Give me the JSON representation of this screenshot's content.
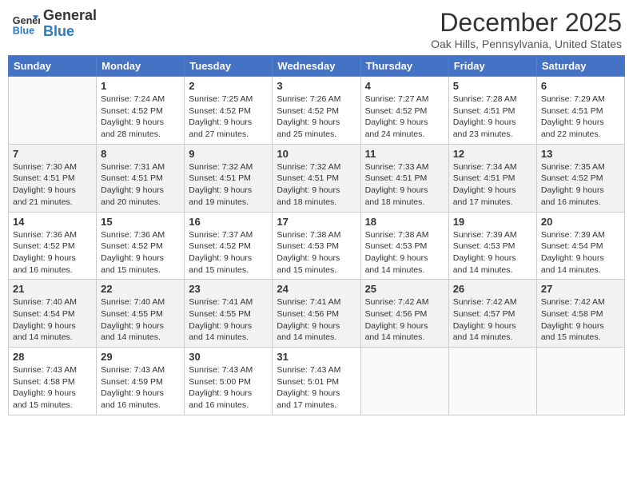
{
  "header": {
    "logo_general": "General",
    "logo_blue": "Blue",
    "month_title": "December 2025",
    "location": "Oak Hills, Pennsylvania, United States"
  },
  "days_of_week": [
    "Sunday",
    "Monday",
    "Tuesday",
    "Wednesday",
    "Thursday",
    "Friday",
    "Saturday"
  ],
  "weeks": [
    [
      {
        "day": "",
        "info": ""
      },
      {
        "day": "1",
        "info": "Sunrise: 7:24 AM\nSunset: 4:52 PM\nDaylight: 9 hours\nand 28 minutes."
      },
      {
        "day": "2",
        "info": "Sunrise: 7:25 AM\nSunset: 4:52 PM\nDaylight: 9 hours\nand 27 minutes."
      },
      {
        "day": "3",
        "info": "Sunrise: 7:26 AM\nSunset: 4:52 PM\nDaylight: 9 hours\nand 25 minutes."
      },
      {
        "day": "4",
        "info": "Sunrise: 7:27 AM\nSunset: 4:52 PM\nDaylight: 9 hours\nand 24 minutes."
      },
      {
        "day": "5",
        "info": "Sunrise: 7:28 AM\nSunset: 4:51 PM\nDaylight: 9 hours\nand 23 minutes."
      },
      {
        "day": "6",
        "info": "Sunrise: 7:29 AM\nSunset: 4:51 PM\nDaylight: 9 hours\nand 22 minutes."
      }
    ],
    [
      {
        "day": "7",
        "info": "Sunrise: 7:30 AM\nSunset: 4:51 PM\nDaylight: 9 hours\nand 21 minutes."
      },
      {
        "day": "8",
        "info": "Sunrise: 7:31 AM\nSunset: 4:51 PM\nDaylight: 9 hours\nand 20 minutes."
      },
      {
        "day": "9",
        "info": "Sunrise: 7:32 AM\nSunset: 4:51 PM\nDaylight: 9 hours\nand 19 minutes."
      },
      {
        "day": "10",
        "info": "Sunrise: 7:32 AM\nSunset: 4:51 PM\nDaylight: 9 hours\nand 18 minutes."
      },
      {
        "day": "11",
        "info": "Sunrise: 7:33 AM\nSunset: 4:51 PM\nDaylight: 9 hours\nand 18 minutes."
      },
      {
        "day": "12",
        "info": "Sunrise: 7:34 AM\nSunset: 4:51 PM\nDaylight: 9 hours\nand 17 minutes."
      },
      {
        "day": "13",
        "info": "Sunrise: 7:35 AM\nSunset: 4:52 PM\nDaylight: 9 hours\nand 16 minutes."
      }
    ],
    [
      {
        "day": "14",
        "info": "Sunrise: 7:36 AM\nSunset: 4:52 PM\nDaylight: 9 hours\nand 16 minutes."
      },
      {
        "day": "15",
        "info": "Sunrise: 7:36 AM\nSunset: 4:52 PM\nDaylight: 9 hours\nand 15 minutes."
      },
      {
        "day": "16",
        "info": "Sunrise: 7:37 AM\nSunset: 4:52 PM\nDaylight: 9 hours\nand 15 minutes."
      },
      {
        "day": "17",
        "info": "Sunrise: 7:38 AM\nSunset: 4:53 PM\nDaylight: 9 hours\nand 15 minutes."
      },
      {
        "day": "18",
        "info": "Sunrise: 7:38 AM\nSunset: 4:53 PM\nDaylight: 9 hours\nand 14 minutes."
      },
      {
        "day": "19",
        "info": "Sunrise: 7:39 AM\nSunset: 4:53 PM\nDaylight: 9 hours\nand 14 minutes."
      },
      {
        "day": "20",
        "info": "Sunrise: 7:39 AM\nSunset: 4:54 PM\nDaylight: 9 hours\nand 14 minutes."
      }
    ],
    [
      {
        "day": "21",
        "info": "Sunrise: 7:40 AM\nSunset: 4:54 PM\nDaylight: 9 hours\nand 14 minutes."
      },
      {
        "day": "22",
        "info": "Sunrise: 7:40 AM\nSunset: 4:55 PM\nDaylight: 9 hours\nand 14 minutes."
      },
      {
        "day": "23",
        "info": "Sunrise: 7:41 AM\nSunset: 4:55 PM\nDaylight: 9 hours\nand 14 minutes."
      },
      {
        "day": "24",
        "info": "Sunrise: 7:41 AM\nSunset: 4:56 PM\nDaylight: 9 hours\nand 14 minutes."
      },
      {
        "day": "25",
        "info": "Sunrise: 7:42 AM\nSunset: 4:56 PM\nDaylight: 9 hours\nand 14 minutes."
      },
      {
        "day": "26",
        "info": "Sunrise: 7:42 AM\nSunset: 4:57 PM\nDaylight: 9 hours\nand 14 minutes."
      },
      {
        "day": "27",
        "info": "Sunrise: 7:42 AM\nSunset: 4:58 PM\nDaylight: 9 hours\nand 15 minutes."
      }
    ],
    [
      {
        "day": "28",
        "info": "Sunrise: 7:43 AM\nSunset: 4:58 PM\nDaylight: 9 hours\nand 15 minutes."
      },
      {
        "day": "29",
        "info": "Sunrise: 7:43 AM\nSunset: 4:59 PM\nDaylight: 9 hours\nand 16 minutes."
      },
      {
        "day": "30",
        "info": "Sunrise: 7:43 AM\nSunset: 5:00 PM\nDaylight: 9 hours\nand 16 minutes."
      },
      {
        "day": "31",
        "info": "Sunrise: 7:43 AM\nSunset: 5:01 PM\nDaylight: 9 hours\nand 17 minutes."
      },
      {
        "day": "",
        "info": ""
      },
      {
        "day": "",
        "info": ""
      },
      {
        "day": "",
        "info": ""
      }
    ]
  ]
}
